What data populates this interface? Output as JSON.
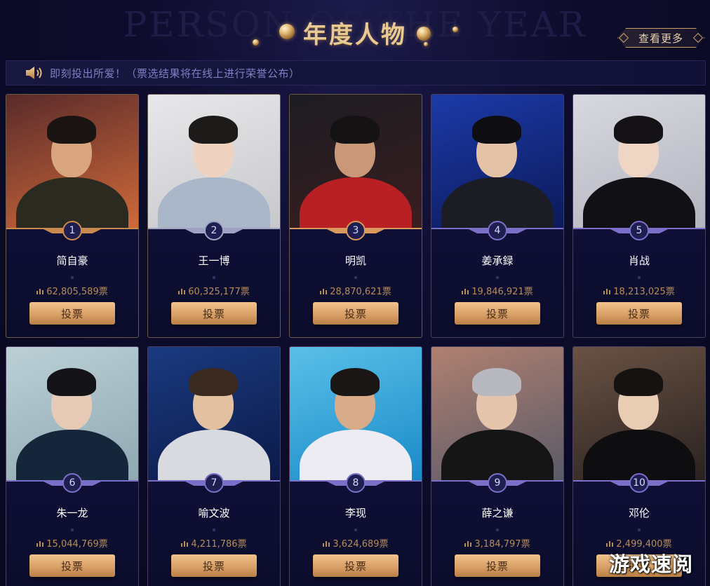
{
  "header": {
    "bg_text": "PERSON OF THE YEAR",
    "title": "年度人物",
    "more_label": "查看更多"
  },
  "notice": {
    "text": "即刻投出所爱！（票选结果将在线上进行荣誉公布）"
  },
  "accent_gold": "#d8a067",
  "candidates": [
    {
      "rank": "1",
      "name": "简自豪",
      "votes": "62,805,589票",
      "vote_label": "投票",
      "medal": "#c98a4e",
      "bg": [
        "#5a2a2a",
        "#d06a3a"
      ],
      "shirt": "#2a2a20",
      "hair": "#1a1412",
      "skin": "#d9a57e"
    },
    {
      "rank": "2",
      "name": "王一博",
      "votes": "60,325,177票",
      "vote_label": "投票",
      "medal": "#9ea3c4",
      "bg": [
        "#e8e8ea",
        "#c8c8cc"
      ],
      "shirt": "#a9b7c8",
      "hair": "#1d1a1a",
      "skin": "#efd3c0"
    },
    {
      "rank": "3",
      "name": "明凯",
      "votes": "28,870,621票",
      "vote_label": "投票",
      "medal": "#d9995c",
      "bg": [
        "#1c1c22",
        "#3a1e20"
      ],
      "shirt": "#b82024",
      "hair": "#141212",
      "skin": "#c99878"
    },
    {
      "rank": "4",
      "name": "姜承録",
      "votes": "19,846,921票",
      "vote_label": "投票",
      "medal": "#7a70c8",
      "bg": [
        "#1c3aa8",
        "#0c1a5a"
      ],
      "shirt": "#1c1c24",
      "hair": "#0e0e12",
      "skin": "#e4c2a6"
    },
    {
      "rank": "5",
      "name": "肖战",
      "votes": "18,213,025票",
      "vote_label": "投票",
      "medal": "#7a70c8",
      "bg": [
        "#d8d8e0",
        "#b4b4c0"
      ],
      "shirt": "#111115",
      "hair": "#151215",
      "skin": "#efd6c4"
    },
    {
      "rank": "6",
      "name": "朱一龙",
      "votes": "15,044,769票",
      "vote_label": "投票",
      "medal": "#7a70c8",
      "bg": [
        "#bcd0d6",
        "#8fa8b2"
      ],
      "shirt": "#15253a",
      "hair": "#141418",
      "skin": "#e6cab6"
    },
    {
      "rank": "7",
      "name": "喻文波",
      "votes": "4,211,786票",
      "vote_label": "投票",
      "medal": "#7a70c8",
      "bg": [
        "#1a3a80",
        "#0c1a48"
      ],
      "shirt": "#d8dae0",
      "hair": "#3a2a20",
      "skin": "#e2c0a0"
    },
    {
      "rank": "8",
      "name": "李现",
      "votes": "3,624,689票",
      "vote_label": "投票",
      "medal": "#7a70c8",
      "bg": [
        "#5ac0e8",
        "#1a8ac8"
      ],
      "shirt": "#ececf2",
      "hair": "#1a1616",
      "skin": "#d8ac8a"
    },
    {
      "rank": "9",
      "name": "薛之谦",
      "votes": "3,184,797票",
      "vote_label": "投票",
      "medal": "#7a70c8",
      "bg": [
        "#b08070",
        "#5a5a68"
      ],
      "shirt": "#151515",
      "hair": "#b8b8c0",
      "skin": "#e4c4aa"
    },
    {
      "rank": "10",
      "name": "邓伦",
      "votes": "2,499,400票",
      "vote_label": "投票",
      "medal": "#7a70c8",
      "bg": [
        "#6a5244",
        "#2a2220"
      ],
      "shirt": "#0e0e10",
      "hair": "#161212",
      "skin": "#e8ccb4"
    }
  ],
  "watermark": "游戏速阅"
}
